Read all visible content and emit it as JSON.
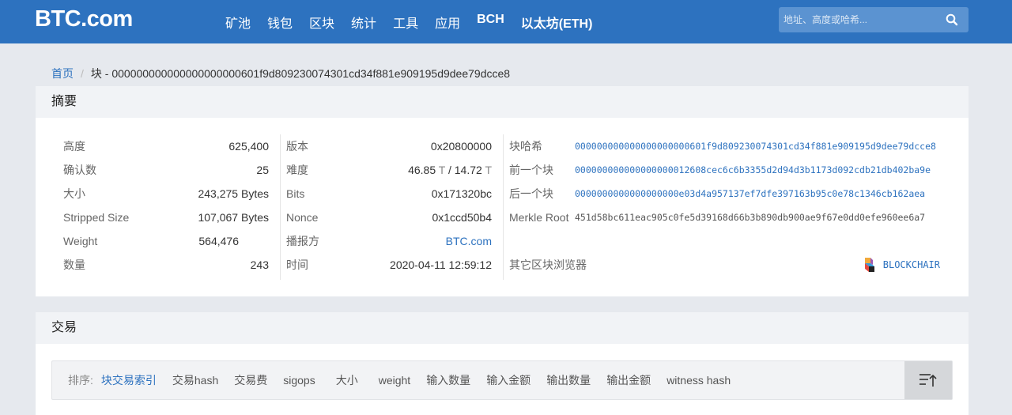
{
  "header": {
    "logo": "BTC.com",
    "nav": [
      "矿池",
      "钱包",
      "区块",
      "统计",
      "工具",
      "应用",
      "BCH",
      "以太坊(ETH)"
    ],
    "search_placeholder": "地址、高度或哈希..."
  },
  "breadcrumb": {
    "home": "首页",
    "separator": "/",
    "current": "块 - 000000000000000000000601f9d809230074301cd34f881e909195d9dee79dcce8"
  },
  "summary": {
    "title": "摘要",
    "col1": [
      {
        "label": "高度",
        "value": "625,400"
      },
      {
        "label": "确认数",
        "value": "25"
      },
      {
        "label": "大小",
        "value": "243,275 Bytes"
      },
      {
        "label": "Stripped Size",
        "value": "107,067 Bytes"
      },
      {
        "label": "Weight",
        "value": "564,476"
      },
      {
        "label": "数量",
        "value": "243"
      }
    ],
    "col2": {
      "version": {
        "label": "版本",
        "value": "0x20800000"
      },
      "difficulty": {
        "label": "难度",
        "v1": "46.85",
        "u1": "T",
        "sep": " / ",
        "v2": "14.72",
        "u2": "T"
      },
      "bits": {
        "label": "Bits",
        "value": "0x171320bc"
      },
      "nonce": {
        "label": "Nonce",
        "value": "0x1ccd50b4"
      },
      "relayer": {
        "label": "播报方",
        "value": "BTC.com"
      },
      "time": {
        "label": "时间",
        "value": "2020-04-11 12:59:12"
      }
    },
    "col3": {
      "block_hash": {
        "label": "块哈希",
        "value": "000000000000000000000601f9d809230074301cd34f881e909195d9dee79dcce8"
      },
      "prev_block": {
        "label": "前一个块",
        "value": "000000000000000000012608cec6c6b3355d2d94d3b1173d092cdb21db402ba9e"
      },
      "next_block": {
        "label": "后一个块",
        "value": "0000000000000000000e03d4a957137ef7dfe397163b95c0e78c1346cb162aea"
      },
      "merkle_root": {
        "label": "Merkle Root",
        "value": "451d58bc611eac905c0fe5d39168d66b3b890db900ae9f67e0dd0efe960ee6a7"
      },
      "other_explorers": {
        "label": "其它区块浏览器",
        "value": "BLOCKCHAIR"
      }
    }
  },
  "transactions": {
    "title": "交易",
    "sort_label": "排序:",
    "sort_options": [
      "块交易索引",
      "交易hash",
      "交易费",
      "sigops",
      "大小",
      "weight",
      "输入数量",
      "输入金额",
      "输出数量",
      "输出金额",
      "witness hash"
    ],
    "active_sort_index": 0
  },
  "colors": {
    "brand_blue": "#2d72bf",
    "background": "#e6e9ee"
  },
  "icons": [
    "search-icon",
    "blockchair-logo-icon",
    "sort-order-icon"
  ]
}
